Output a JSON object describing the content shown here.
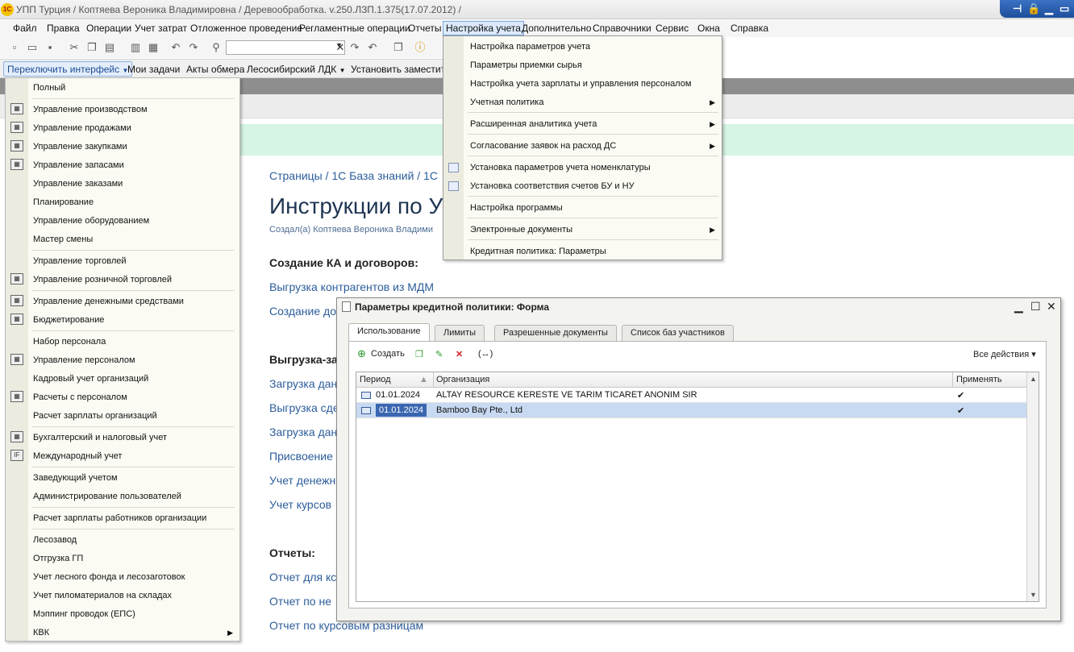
{
  "window": {
    "title": "УПП Турция / Коптяева Вероника Владимировна /  Деревообработка. v.250.ЛЗП.1.375(17.07.2012) /",
    "logo": "1С"
  },
  "menubar": [
    "Файл",
    "Правка",
    "Операции",
    "Учет затрат",
    "Отложенное проведение",
    "Регламентные операции",
    "Отчеты",
    "Настройка учета",
    "Дополнительно",
    "Справочники",
    "Сервис",
    "Окна",
    "Справка"
  ],
  "panel": {
    "switch_label": "Переключить интерфейс",
    "items": [
      "Мои задачи",
      "Акты обмера",
      "Лесосибирский ЛДК",
      "Установить заместите"
    ]
  },
  "interface_menu": {
    "items": [
      "Полный",
      "Управление производством",
      "Управление продажами",
      "Управление закупками",
      "Управление запасами",
      "Управление заказами",
      "Планирование",
      "Управление оборудованием",
      "Мастер смены",
      "Управление торговлей",
      "Управление розничной торговлей",
      "Управление денежными средствами",
      "Бюджетирование",
      "Набор персонала",
      "Управление персоналом",
      "Кадровый учет организаций",
      "Расчеты с персоналом",
      "Расчет зарплаты организаций",
      "Бухгалтерский и налоговый учет",
      "Международный учет",
      "Заведующий учетом",
      "Администрирование пользователей",
      "Расчет зарплаты работников организации",
      "Лесозавод",
      "Отгрузка ГП",
      "Учет лесного фонда и лесозаготовок",
      "Учет пиломатериалов на складах",
      "Мэппинг проводок (ЕПС)",
      "КВК"
    ]
  },
  "settings_menu": {
    "items": [
      "Настройка параметров учета",
      "Параметры приемки сырья",
      "Настройка учета зарплаты и управления персоналом",
      "Учетная политика",
      "Расширенная аналитика учета",
      "Согласование заявок на расход ДС",
      "Установка параметров учета номенклатуры",
      "Установка соответствия счетов БУ и НУ",
      "Настройка программы",
      "Электронные документы",
      "Кредитная политика: Параметры"
    ]
  },
  "wiki": {
    "breadcrumb": "Страницы  /  1С База знаний  /  1С",
    "title": "Инструкции по У",
    "author": "Создал(а) Коптяева Вероника Владими",
    "section1": "Создание КА и договоров:",
    "links1": [
      "Выгрузка контрагентов из МДМ",
      "Создание до"
    ],
    "section2": "Выгрузка-за",
    "links2": [
      "Загрузка дан",
      "Выгрузка сде",
      "Загрузка дан",
      "Присвоение",
      "Учет денежн",
      "Учет курсов"
    ],
    "section3": "Отчеты:",
    "links3": [
      "Отчет для кс",
      "Отчет по не",
      "Отчет по курсовым разницам"
    ]
  },
  "form": {
    "title": "Параметры кредитной политики: Форма",
    "tabs": [
      "Использование",
      "Лимиты",
      "Разрешенные документы",
      "Список баз участников"
    ],
    "create_label": "Создать",
    "all_actions": "Все действия",
    "columns": [
      "Период",
      "Организация",
      "Применять"
    ],
    "rows": [
      {
        "period": "01.01.2024",
        "org": "ALTAY RESOURCE KERESTE VE TARIM TICARET ANONIM SIR",
        "apply": "✔"
      },
      {
        "period": "01.01.2024",
        "org": "Bamboo Bay Pte., Ltd",
        "apply": "✔"
      }
    ]
  }
}
